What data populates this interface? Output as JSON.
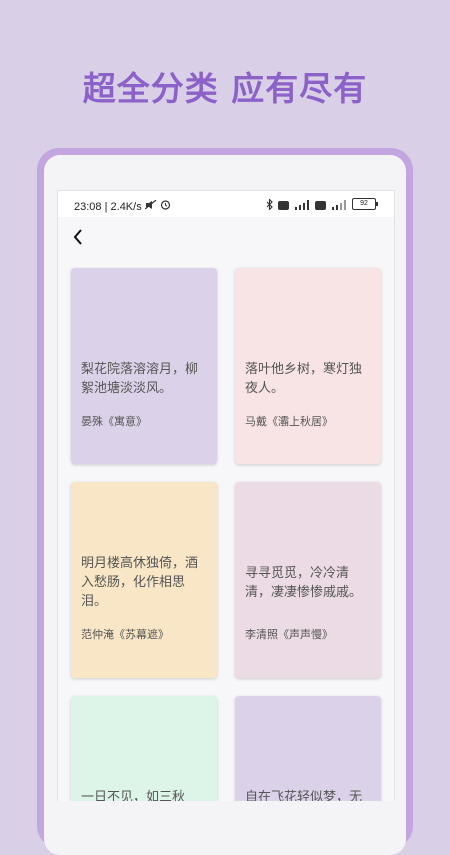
{
  "headline": "超全分类 应有尽有",
  "status_bar": {
    "time": "23:08",
    "speed": "2.4K/s",
    "battery": "92"
  },
  "cards": [
    {
      "text": "梨花院落溶溶月，柳絮池塘淡淡风。",
      "author": "晏殊《寓意》",
      "color": "#dbd2e9"
    },
    {
      "text": "落叶他乡树，寒灯独夜人。",
      "author": "马戴《灞上秋居》",
      "color": "#f8e4e5"
    },
    {
      "text": "明月楼高休独倚，酒入愁肠，化作相思泪。",
      "author": "范仲淹《苏幕遮》",
      "color": "#f8e6c6"
    },
    {
      "text": "寻寻觅觅，冷冷清清，凄凄惨惨戚戚。",
      "author": "李清照《声声慢》",
      "color": "#ecdbe4"
    },
    {
      "text": "一日不见，如三秋",
      "author": "",
      "color": "#ddf4e9"
    },
    {
      "text": "自在飞花轻似梦，无",
      "author": "",
      "color": "#dbd2e9"
    }
  ]
}
